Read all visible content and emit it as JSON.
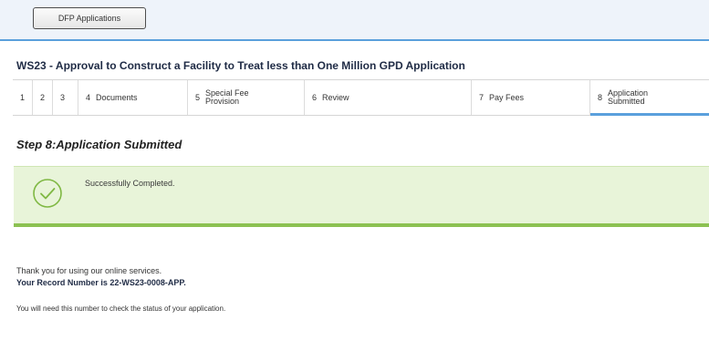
{
  "header": {
    "dfp_button_label": "DFP Applications"
  },
  "application": {
    "title": "WS23 - Approval to Construct a Facility to Treat less than One Million GPD Application"
  },
  "steps": [
    {
      "num": "1",
      "label": ""
    },
    {
      "num": "2",
      "label": ""
    },
    {
      "num": "3",
      "label": ""
    },
    {
      "num": "4",
      "label": "Documents"
    },
    {
      "num": "5",
      "label": "Special Fee Provision"
    },
    {
      "num": "6",
      "label": "Review"
    },
    {
      "num": "7",
      "label": "Pay Fees"
    },
    {
      "num": "8",
      "label": "Application Submitted"
    }
  ],
  "active_step_index": 7,
  "step_heading": "Step 8:Application Submitted",
  "success": {
    "message": "Successfully Completed."
  },
  "confirmation": {
    "thanks": "Thank you for using our online services.",
    "record_prefix": "Your Record Number is ",
    "record_number": "22-WS23-0008-APP.",
    "note": "You will need this number to check the status of your application."
  },
  "colors": {
    "accent_blue": "#5aa0dc",
    "success_green": "#8cc152",
    "success_bg": "#e8f4d9"
  },
  "icons": {
    "success": "check-circle-icon"
  }
}
